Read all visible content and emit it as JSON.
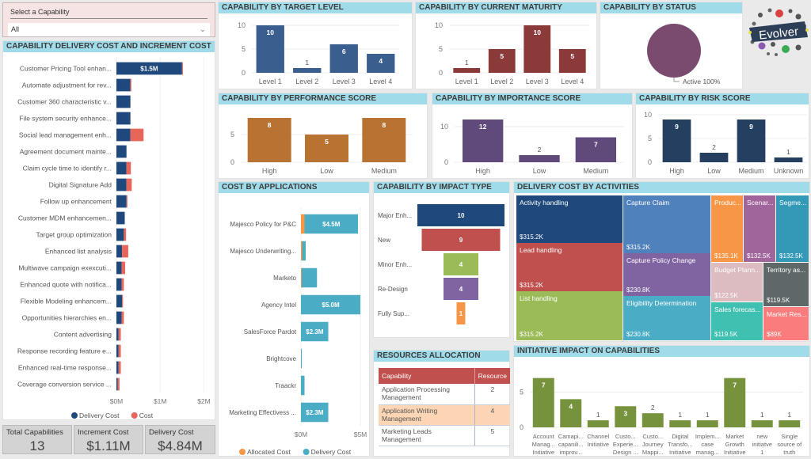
{
  "slicer": {
    "label": "Select a Capability",
    "value": "All"
  },
  "kpis": [
    {
      "label": "Total Capabilities",
      "value": "13"
    },
    {
      "label": "Increment Cost",
      "value": "$1.11M"
    },
    {
      "label": "Delivery Cost",
      "value": "$4.84M"
    }
  ],
  "logo": {
    "text": "Evolver"
  },
  "colors": {
    "header": "#9fdbe9",
    "delivery": "#1f497d",
    "cost": "#e8655a",
    "allocated": "#f79646",
    "app_delivery": "#4bacc6"
  },
  "chart_data": [
    {
      "id": "delivery_increment",
      "type": "bar",
      "orientation": "horizontal",
      "stacked": true,
      "title": "CAPABILITY DELIVERY COST AND INCREMENT COST",
      "categories": [
        "Customer Pricing Tool enhan...",
        "Automate adjustment for rev...",
        "Customer 360 characteristic v...",
        "File system security enhance...",
        "Social lead management enh...",
        "Agreement document mainte...",
        "Claim cycle time to identify r...",
        "Digital Signature Add",
        "Follow up enhancement",
        "Customer MDM enhancemen...",
        "Target group optimization",
        "Enhanced list analysis",
        "Multiwave campaign exexcuti...",
        "Enhanced quote with notifica...",
        "Flexible Modeling enhancem...",
        "Opportunities hierarchies en...",
        "Content advertising",
        "Response recording feature e...",
        "Enhanced real-time response...",
        "Coverage conversion service ..."
      ],
      "series": [
        {
          "name": "Delivery Cost",
          "color": "#1f497d",
          "values": [
            1.5,
            0.32,
            0.32,
            0.32,
            0.32,
            0.23,
            0.23,
            0.23,
            0.23,
            0.19,
            0.17,
            0.13,
            0.12,
            0.12,
            0.13,
            0.12,
            0.05,
            0.05,
            0.05,
            0.03
          ]
        },
        {
          "name": "Cost",
          "color": "#e8655a",
          "values": [
            0.02,
            0.02,
            0,
            0,
            0.3,
            0,
            0.1,
            0.12,
            0.02,
            0,
            0.05,
            0.14,
            0.08,
            0.05,
            0.02,
            0.05,
            0.05,
            0.05,
            0.05,
            0.04
          ]
        }
      ],
      "data_labels": [
        "$1.5M"
      ],
      "xticks": [
        "$0M",
        "$1M",
        "$2M"
      ],
      "xlim": [
        0,
        2.1
      ],
      "legend": [
        "Delivery Cost",
        "Cost"
      ],
      "legend_position": "bottom"
    },
    {
      "id": "target_level",
      "type": "bar",
      "title": "CAPABILITY BY TARGET LEVEL",
      "categories": [
        "Level 1",
        "Level 2",
        "Level 3",
        "Level 4"
      ],
      "values": [
        10,
        1,
        6,
        4
      ],
      "color": "#3a5f8f",
      "yticks": [
        0,
        5,
        10
      ],
      "ylim": [
        0,
        10.5
      ]
    },
    {
      "id": "current_maturity",
      "type": "bar",
      "title": "CAPABILITY BY CURRENT MATURITY",
      "categories": [
        "Level 1",
        "Level 2",
        "Level 3",
        "Level 4"
      ],
      "values": [
        1,
        5,
        10,
        5
      ],
      "color": "#8b3a3a",
      "yticks": [
        0,
        5,
        10
      ],
      "ylim": [
        0,
        10.5
      ]
    },
    {
      "id": "status",
      "type": "pie",
      "title": "CAPABILITY BY STATUS",
      "categories": [
        "Active"
      ],
      "values": [
        100
      ],
      "labels": [
        "Active 100%"
      ],
      "color": "#7a4b6e"
    },
    {
      "id": "performance",
      "type": "bar",
      "title": "CAPABILITY BY PERFORMANCE SCORE",
      "categories": [
        "High",
        "Low",
        "Medium"
      ],
      "values": [
        8,
        5,
        8
      ],
      "color": "#b87333",
      "yticks": [
        0,
        5
      ],
      "ylim": [
        0,
        9
      ]
    },
    {
      "id": "importance",
      "type": "bar",
      "title": "CAPABILITY BY IMPORTANCE SCORE",
      "categories": [
        "High",
        "Low",
        "Medium"
      ],
      "values": [
        12,
        2,
        7
      ],
      "color": "#604a7b",
      "yticks": [
        0,
        10
      ],
      "ylim": [
        0,
        14
      ]
    },
    {
      "id": "risk",
      "type": "bar",
      "title": "CAPABILITY BY RISK SCORE",
      "categories": [
        "High",
        "Low",
        "Medium",
        "Unknown"
      ],
      "values": [
        9,
        2,
        9,
        1
      ],
      "color": "#243f60",
      "yticks": [
        0,
        5,
        10
      ],
      "ylim": [
        0,
        10.5
      ]
    },
    {
      "id": "cost_by_apps",
      "type": "bar",
      "orientation": "horizontal",
      "stacked": true,
      "title": "COST BY APPLICATIONS",
      "categories": [
        "Majesco Policy for P&C",
        "Majesco Underwriting...",
        "Marketo",
        "Agency Intel",
        "SalesForce Pardot",
        "Brightcove",
        "Traackr",
        "Marketing Effectivess ..."
      ],
      "series": [
        {
          "name": "Allocated Cost",
          "color": "#f79646",
          "values": [
            0.3,
            0.1,
            0.05,
            0,
            0,
            0,
            0,
            0
          ]
        },
        {
          "name": "Delivery Cost",
          "color": "#4bacc6",
          "values": [
            4.5,
            0.3,
            1.3,
            5.0,
            2.3,
            0.05,
            0.3,
            2.3
          ]
        }
      ],
      "data_labels": [
        "$4.5M",
        "",
        "",
        "$5.0M",
        "$2.3M",
        "",
        "",
        "$2.3M"
      ],
      "xticks": [
        "$0M",
        "$5M"
      ],
      "xlim": [
        0,
        5.2
      ],
      "legend": [
        "Allocated Cost",
        "Delivery Cost"
      ],
      "legend_position": "bottom"
    },
    {
      "id": "impact_type",
      "type": "funnel",
      "title": "CAPABILITY BY IMPACT TYPE",
      "categories": [
        "Major Enh...",
        "New",
        "Minor Enh...",
        "Re-Design",
        "Fully Sup..."
      ],
      "values": [
        10,
        9,
        4,
        4,
        1
      ],
      "colors": [
        "#1f497d",
        "#c0504d",
        "#9bbb59",
        "#8064a2",
        "#f79646"
      ]
    },
    {
      "id": "activities",
      "type": "treemap",
      "title": "DELIVERY COST BY ACTIVITIES",
      "items": [
        {
          "label": "Activity handling",
          "value": "$315.2K",
          "color": "#1f497d"
        },
        {
          "label": "Lead handling",
          "value": "$315.2K",
          "color": "#c0504d"
        },
        {
          "label": "List handling",
          "value": "$315.2K",
          "color": "#9bbb59"
        },
        {
          "label": "Capture Claim",
          "value": "$315.2K",
          "color": "#4f81bd"
        },
        {
          "label": "Capture Policy Change",
          "value": "$230.8K",
          "color": "#8064a2"
        },
        {
          "label": "Eligibility Determination",
          "value": "$230.8K",
          "color": "#4bacc6"
        },
        {
          "label": "Produc...",
          "value": "$135.1K",
          "color": "#f79646"
        },
        {
          "label": "Scenar...",
          "value": "$132.5K",
          "color": "#a0659a"
        },
        {
          "label": "Segme...",
          "value": "$132.5K",
          "color": "#3399b6"
        },
        {
          "label": "Budget Plann...",
          "value": "$122.5K",
          "color": "#dcbcc0"
        },
        {
          "label": "Territory as...",
          "value": "$119.5K",
          "color": "#5f6869"
        },
        {
          "label": "Sales forecas...",
          "value": "$119.5K",
          "color": "#40c0b0"
        },
        {
          "label": "Market Res...",
          "value": "$89K",
          "color": "#fb7c7c"
        }
      ]
    },
    {
      "id": "resources",
      "type": "table",
      "title": "RESOURCES ALLOCATION",
      "columns": [
        "Capability",
        "Resource"
      ],
      "rows": [
        [
          "Application Processing Management",
          "2"
        ],
        [
          "Application Writing Management",
          "4"
        ],
        [
          "Marketing Leads Management",
          "5"
        ]
      ],
      "highlighted_row": 1
    },
    {
      "id": "initiative_impact",
      "type": "bar",
      "title": "INITIATIVE IMPACT ON CAPABILITIES",
      "categories": [
        [
          "Account",
          "Manag...",
          "Initiative"
        ],
        [
          "Camapi...",
          "capanili...",
          "improv..."
        ],
        [
          "Channel",
          "Initiative"
        ],
        [
          "Custo...",
          "Experie...",
          "Design ..."
        ],
        [
          "Custo...",
          "Journey",
          "Mappi..."
        ],
        [
          "Digital",
          "Transfo...",
          "Initiative"
        ],
        [
          "Implem...",
          "case",
          "manag..."
        ],
        [
          "Market",
          "Growth",
          "Initiative"
        ],
        [
          "new",
          "initiatve",
          "1"
        ],
        [
          "Single",
          "source of",
          "truth"
        ]
      ],
      "values": [
        7,
        4,
        1,
        3,
        2,
        1,
        1,
        7,
        1,
        1
      ],
      "color": "#76923c",
      "yticks": [
        0,
        5
      ],
      "ylim": [
        0,
        8.2
      ]
    }
  ]
}
